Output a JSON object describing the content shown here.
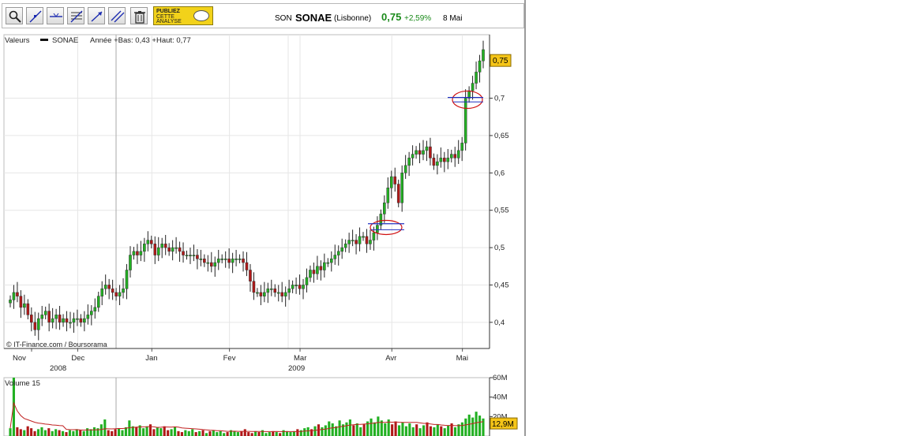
{
  "toolbar": {
    "tools": [
      "zoom-icon",
      "line-draw-icon",
      "horizontal-line-icon",
      "fibonacci-icon",
      "trend-arrow-icon",
      "parallel-lines-icon",
      "trash-icon"
    ],
    "publish": {
      "line1": "PUBLIEZ",
      "line2": "CETTE",
      "line3": "ANALYSE"
    }
  },
  "header": {
    "ticker": "SON",
    "name": "SONAE",
    "exchange": "(Lisbonne)",
    "price": "0,75",
    "change": "+2,59%",
    "date": "8 Mai",
    "price_color": "#1a8a1a"
  },
  "chart_data": [
    {
      "type": "candlestick",
      "legend": {
        "label": "Valeurs",
        "series": "SONAE",
        "info": "Année +Bas: 0,43 +Haut: 0,77"
      },
      "credit": "© IT-Finance.com / Boursorama",
      "ylim": [
        0.365,
        0.785
      ],
      "yticks": [
        0.4,
        0.45,
        0.5,
        0.55,
        0.6,
        0.65,
        0.7
      ],
      "ytick_labels": [
        "0,4",
        "0,45",
        "0,5",
        "0,55",
        "0,6",
        "0,65",
        "0,7"
      ],
      "last_price_label": "0,75",
      "x_months": [
        "Nov",
        "Dec",
        "Jan",
        "Fev",
        "Mar",
        "Avr",
        "Mai"
      ],
      "x_years": [
        "2008",
        "2009"
      ],
      "up_color": "#22b022",
      "down_color": "#b01818",
      "closes": [
        0.43,
        0.44,
        0.435,
        0.42,
        0.425,
        0.41,
        0.4,
        0.39,
        0.405,
        0.41,
        0.415,
        0.4,
        0.405,
        0.41,
        0.4,
        0.405,
        0.4,
        0.4,
        0.405,
        0.405,
        0.4,
        0.405,
        0.41,
        0.415,
        0.42,
        0.435,
        0.445,
        0.45,
        0.445,
        0.44,
        0.435,
        0.44,
        0.445,
        0.47,
        0.49,
        0.495,
        0.49,
        0.495,
        0.505,
        0.51,
        0.505,
        0.49,
        0.5,
        0.505,
        0.5,
        0.495,
        0.5,
        0.5,
        0.495,
        0.49,
        0.49,
        0.49,
        0.49,
        0.485,
        0.485,
        0.48,
        0.48,
        0.475,
        0.48,
        0.485,
        0.485,
        0.485,
        0.48,
        0.485,
        0.485,
        0.485,
        0.48,
        0.47,
        0.455,
        0.44,
        0.44,
        0.435,
        0.44,
        0.445,
        0.445,
        0.44,
        0.44,
        0.435,
        0.44,
        0.445,
        0.45,
        0.45,
        0.445,
        0.45,
        0.46,
        0.47,
        0.465,
        0.475,
        0.47,
        0.48,
        0.48,
        0.485,
        0.49,
        0.495,
        0.5,
        0.505,
        0.51,
        0.51,
        0.505,
        0.515,
        0.515,
        0.505,
        0.51,
        0.52,
        0.53,
        0.545,
        0.56,
        0.58,
        0.595,
        0.585,
        0.56,
        0.6,
        0.61,
        0.62,
        0.625,
        0.63,
        0.625,
        0.63,
        0.635,
        0.62,
        0.61,
        0.615,
        0.62,
        0.615,
        0.62,
        0.625,
        0.62,
        0.63,
        0.64,
        0.7,
        0.71,
        0.72,
        0.735,
        0.75,
        0.765
      ],
      "volume": {
        "label": "Volume 15",
        "ylim": [
          0,
          60
        ],
        "yticks": [
          20,
          40,
          60
        ],
        "ytick_labels": [
          "20M",
          "40M",
          "60M"
        ],
        "last_label": "12,9M",
        "values": [
          8,
          60,
          9,
          7,
          6,
          10,
          8,
          5,
          7,
          9,
          6,
          8,
          5,
          7,
          6,
          5,
          4,
          6,
          5,
          7,
          6,
          5,
          8,
          7,
          9,
          8,
          12,
          17,
          6,
          5,
          7,
          8,
          6,
          9,
          16,
          10,
          9,
          11,
          8,
          10,
          12,
          7,
          9,
          8,
          10,
          6,
          7,
          9,
          5,
          4,
          6,
          5,
          7,
          4,
          5,
          6,
          3,
          5,
          6,
          4,
          5,
          3,
          4,
          6,
          5,
          4,
          5,
          7,
          4,
          3,
          5,
          4,
          6,
          3,
          4,
          5,
          4,
          3,
          6,
          5,
          4,
          5,
          7,
          6,
          8,
          9,
          7,
          10,
          12,
          9,
          11,
          15,
          13,
          10,
          16,
          12,
          14,
          17,
          11,
          13,
          9,
          12,
          15,
          18,
          14,
          20,
          16,
          13,
          17,
          12,
          15,
          11,
          14,
          10,
          13,
          9,
          12,
          8,
          11,
          14,
          10,
          9,
          12,
          10,
          8,
          11,
          13,
          9,
          12,
          14,
          18,
          22,
          19,
          25,
          21,
          18
        ]
      },
      "moving_average_color": "#c02020"
    }
  ]
}
